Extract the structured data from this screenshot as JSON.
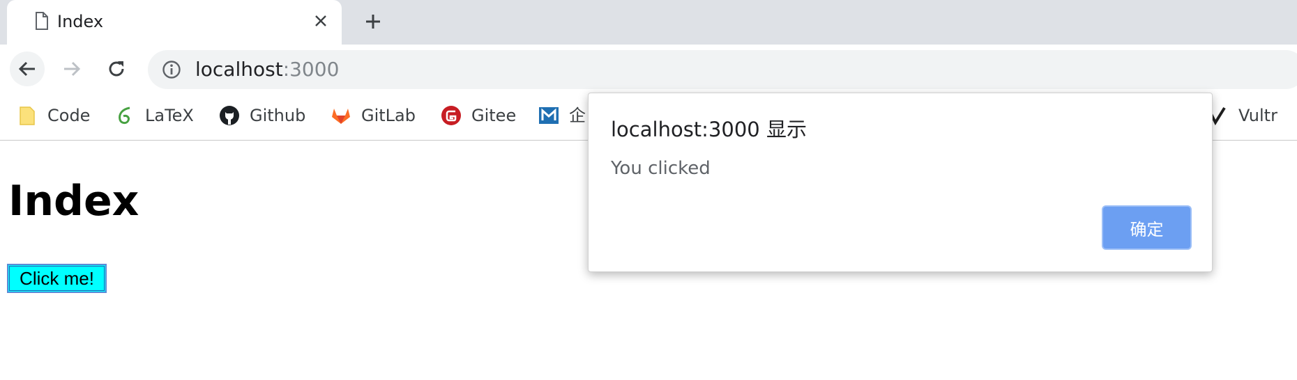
{
  "tab": {
    "title": "Index"
  },
  "toolbar": {
    "url_host": "localhost",
    "url_port": ":3000"
  },
  "bookmarks": [
    {
      "label": "Code",
      "icon": "folder-icon"
    },
    {
      "label": "LaTeX",
      "icon": "overleaf-icon"
    },
    {
      "label": "Github",
      "icon": "github-icon"
    },
    {
      "label": "GitLab",
      "icon": "gitlab-icon"
    },
    {
      "label": "Gitee",
      "icon": "gitee-icon"
    },
    {
      "label": "企",
      "icon": "bookmark-blue-icon"
    },
    {
      "label": "Vultr",
      "icon": "vultr-icon"
    }
  ],
  "page": {
    "heading": "Index",
    "button_label": "Click me!"
  },
  "dialog": {
    "title": "localhost:3000 显示",
    "message": "You clicked",
    "ok_label": "确定"
  },
  "colors": {
    "button_bg": "#00ffff",
    "dialog_ok": "#6c9ff2",
    "gitee": "#c71d23",
    "gitlab": "#fc6d26"
  }
}
